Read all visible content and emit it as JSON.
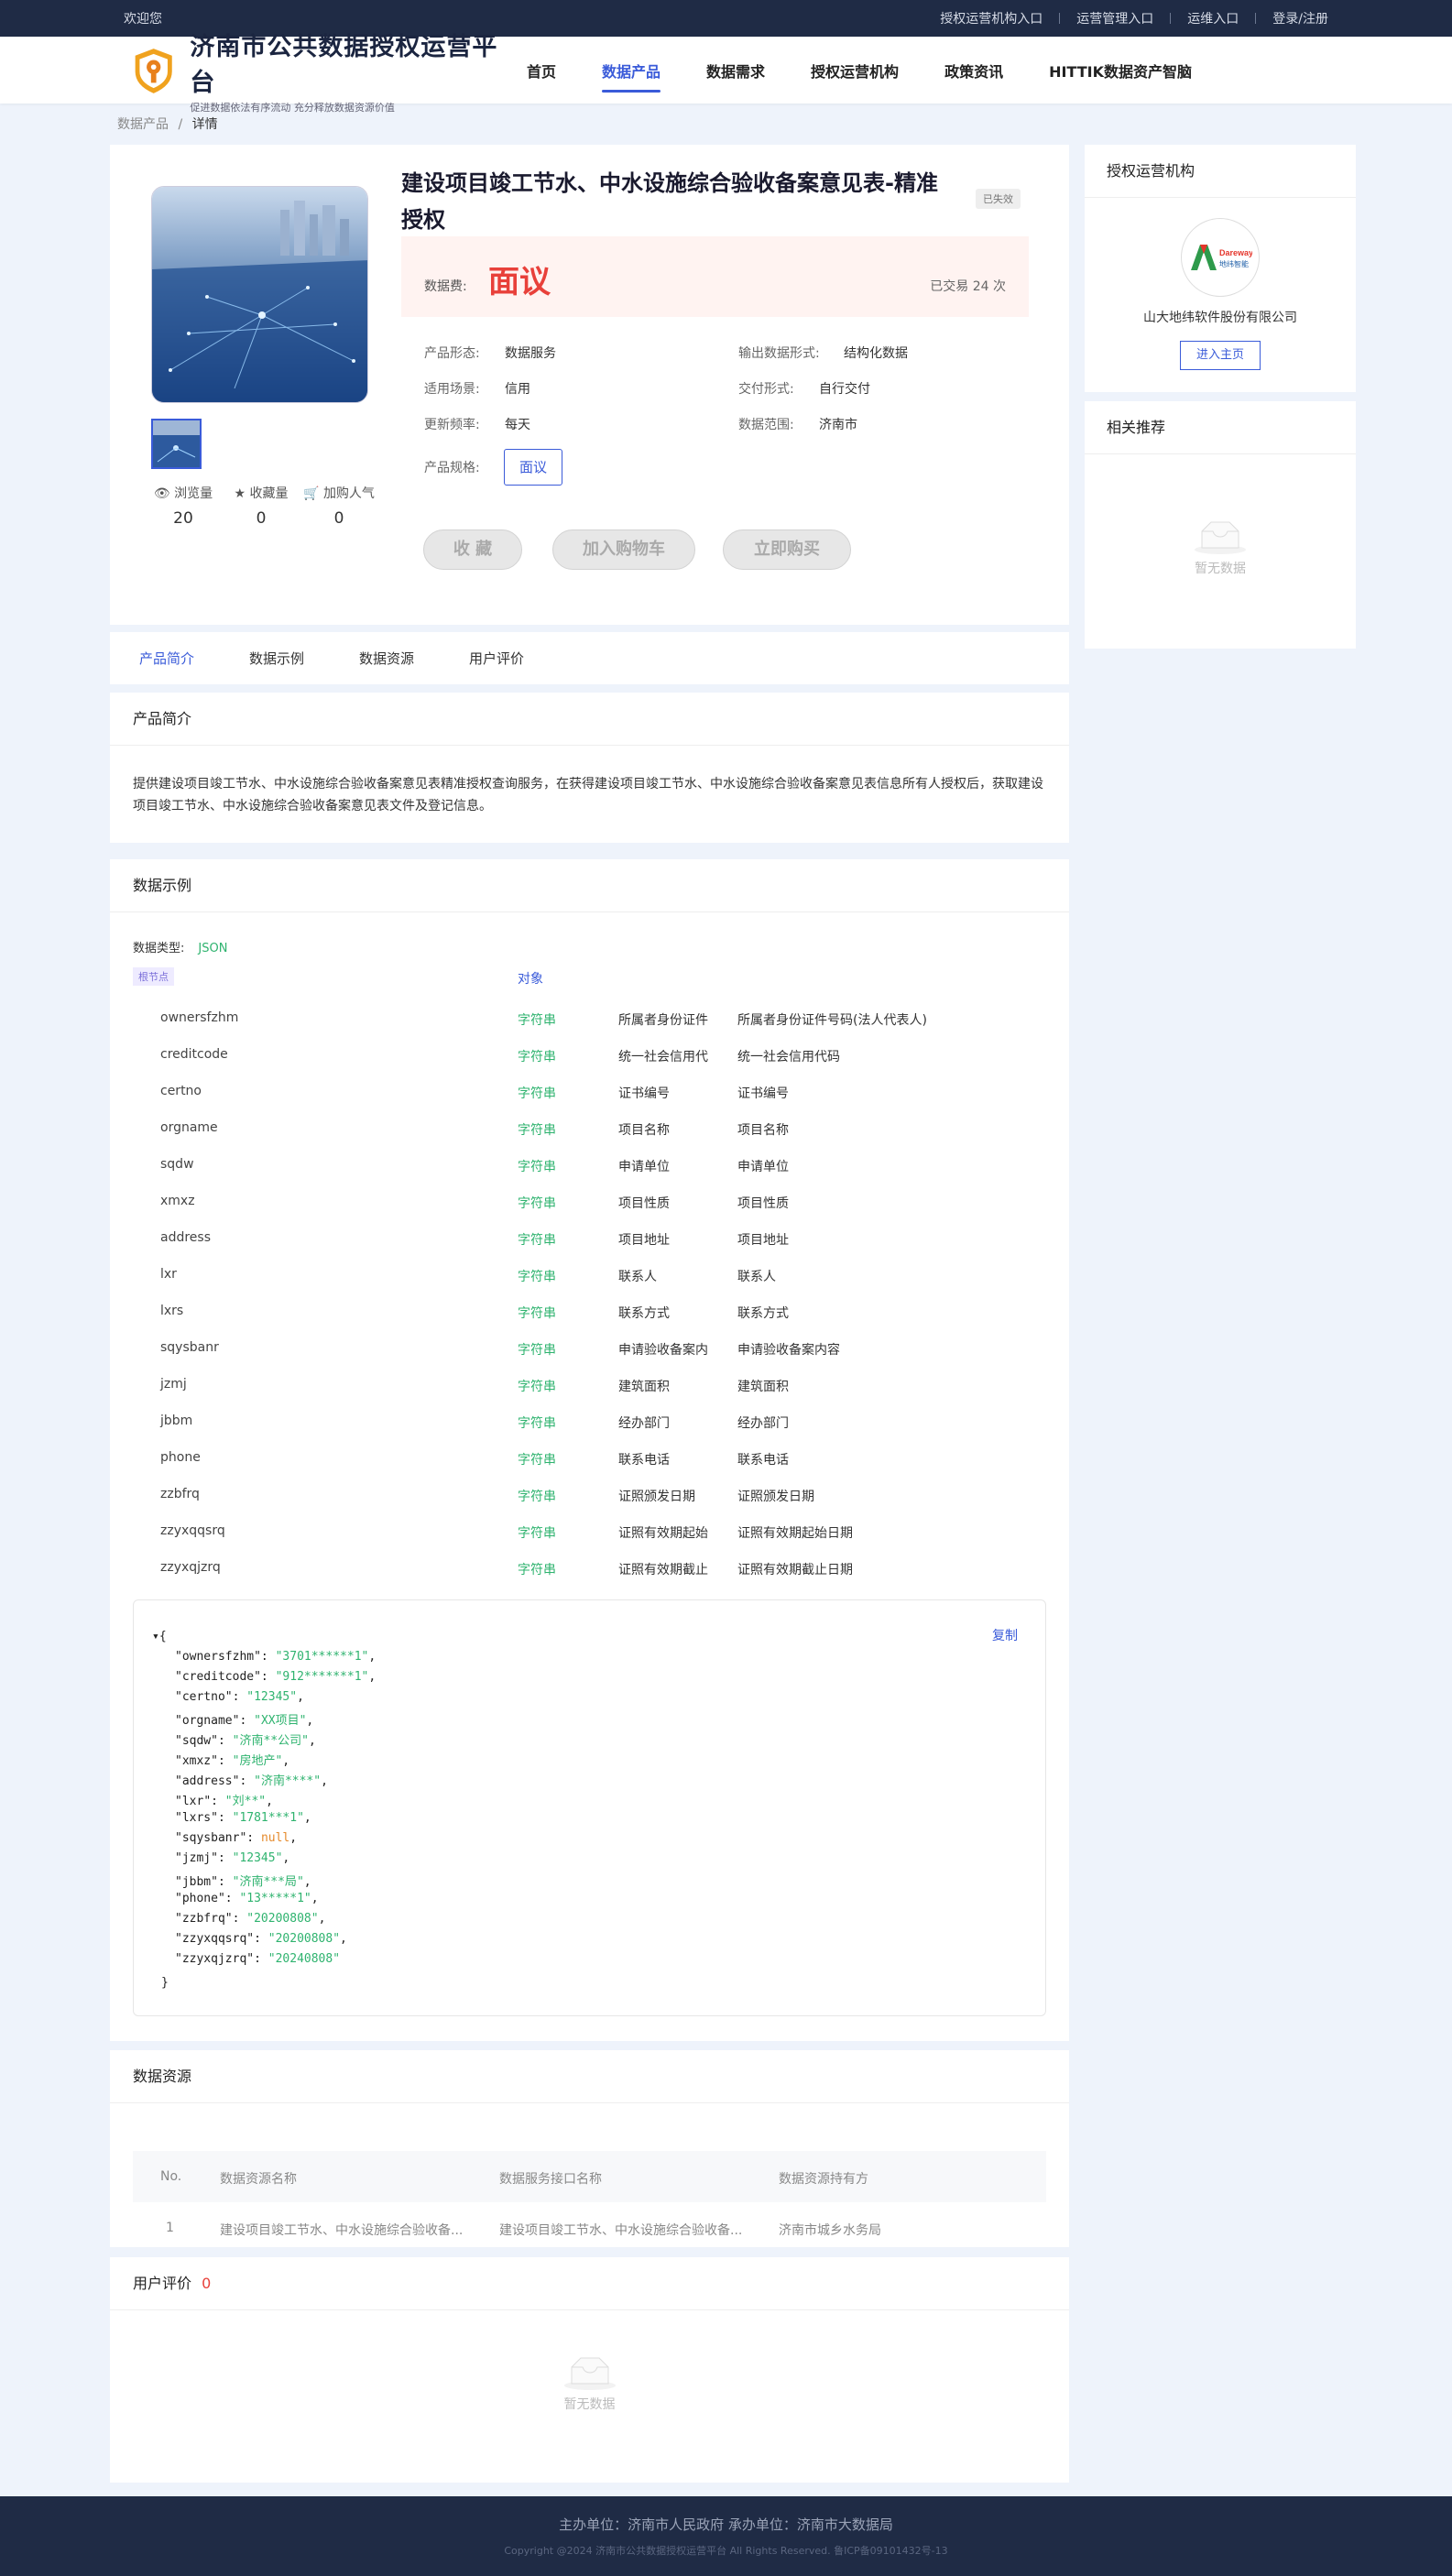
{
  "topbar": {
    "welcome": "欢迎您",
    "links": [
      "授权运营机构入口",
      "运营管理入口",
      "运维入口",
      "登录/注册"
    ]
  },
  "header": {
    "title": "济南市公共数据授权运营平台",
    "subtitle": "促进数据依法有序流动 充分释放数据资源价值"
  },
  "nav": [
    {
      "label": "首页",
      "active": false
    },
    {
      "label": "数据产品",
      "active": true
    },
    {
      "label": "数据需求",
      "active": false
    },
    {
      "label": "授权运营机构",
      "active": false
    },
    {
      "label": "政策资讯",
      "active": false
    },
    {
      "label": "HITTIK数据资产智脑",
      "active": false
    }
  ],
  "breadcrumb": {
    "parent": "数据产品",
    "sep": "/",
    "current": "详情"
  },
  "product": {
    "title": "建设项目竣工节水、中水设施综合验收备案意见表-精准授权",
    "status": "已失效",
    "price_label": "数据费:",
    "price": "面议",
    "traded": "已交易 24 次",
    "attrs": {
      "form_k": "产品形态:",
      "form_v": "数据服务",
      "output_k": "输出数据形式:",
      "output_v": "结构化数据",
      "scene_k": "适用场景:",
      "scene_v": "信用",
      "delivery_k": "交付形式:",
      "delivery_v": "自行交付",
      "freq_k": "更新频率:",
      "freq_v": "每天",
      "range_k": "数据范围:",
      "range_v": "济南市",
      "spec_k": "产品规格:",
      "spec_v": "面议"
    },
    "stats": [
      {
        "label": "浏览量",
        "value": "20"
      },
      {
        "label": "收藏量",
        "value": "0"
      },
      {
        "label": "加购人气",
        "value": "0"
      }
    ],
    "buttons": {
      "fav": "收 藏",
      "cart": "加入购物车",
      "buy": "立即购买"
    }
  },
  "org": {
    "section": "授权运营机构",
    "logo_top": "Dareway",
    "logo_bottom": "地纬智能",
    "name": "山大地纬软件股份有限公司",
    "home_btn": "进入主页"
  },
  "related": {
    "section": "相关推荐",
    "empty": "暂无数据"
  },
  "tabs": [
    "产品简介",
    "数据示例",
    "数据资源",
    "用户评价"
  ],
  "intro": {
    "section": "产品简介",
    "text": "提供建设项目竣工节水、中水设施综合验收备案意见表精准授权查询服务，在获得建设项目竣工节水、中水设施综合验收备案意见表信息所有人授权后，获取建设项目竣工节水、中水设施综合验收备案意见表文件及登记信息。"
  },
  "sample": {
    "section": "数据示例",
    "type_label": "数据类型:",
    "type_value": "JSON",
    "root": "根节点",
    "object": "对象",
    "fields": [
      [
        "ownersfzhm",
        "字符串",
        "所属者身份证件",
        "所属者身份证件号码(法人代表人)"
      ],
      [
        "creditcode",
        "字符串",
        "统一社会信用代",
        "统一社会信用代码"
      ],
      [
        "certno",
        "字符串",
        "证书编号",
        "证书编号"
      ],
      [
        "orgname",
        "字符串",
        "项目名称",
        "项目名称"
      ],
      [
        "sqdw",
        "字符串",
        "申请单位",
        "申请单位"
      ],
      [
        "xmxz",
        "字符串",
        "项目性质",
        "项目性质"
      ],
      [
        "address",
        "字符串",
        "项目地址",
        "项目地址"
      ],
      [
        "lxr",
        "字符串",
        "联系人",
        "联系人"
      ],
      [
        "lxrs",
        "字符串",
        "联系方式",
        "联系方式"
      ],
      [
        "sqysbanr",
        "字符串",
        "申请验收备案内",
        "申请验收备案内容"
      ],
      [
        "jzmj",
        "字符串",
        "建筑面积",
        "建筑面积"
      ],
      [
        "jbbm",
        "字符串",
        "经办部门",
        "经办部门"
      ],
      [
        "phone",
        "字符串",
        "联系电话",
        "联系电话"
      ],
      [
        "zzbfrq",
        "字符串",
        "证照颁发日期",
        "证照颁发日期"
      ],
      [
        "zzyxqqsrq",
        "字符串",
        "证照有效期起始",
        "证照有效期起始日期"
      ],
      [
        "zzyxqjzrq",
        "字符串",
        "证照有效期截止",
        "证照有效期截止日期"
      ]
    ],
    "copy": "复制",
    "json": [
      [
        "ownersfzhm",
        "3701******1"
      ],
      [
        "creditcode",
        "912*******1"
      ],
      [
        "certno",
        "12345"
      ],
      [
        "orgname",
        "XX项目"
      ],
      [
        "sqdw",
        "济南**公司"
      ],
      [
        "xmxz",
        "房地产"
      ],
      [
        "address",
        "济南****"
      ],
      [
        "lxr",
        "刘**"
      ],
      [
        "lxrs",
        "1781***1"
      ],
      [
        "sqysbanr",
        null
      ],
      [
        "jzmj",
        "12345"
      ],
      [
        "jbbm",
        "济南***局"
      ],
      [
        "phone",
        "13*****1"
      ],
      [
        "zzbfrq",
        "20200808"
      ],
      [
        "zzyxqqsrq",
        "20200808"
      ],
      [
        "zzyxqjzrq",
        "20240808"
      ]
    ]
  },
  "resources": {
    "section": "数据资源",
    "headers": [
      "No.",
      "数据资源名称",
      "数据服务接口名称",
      "数据资源持有方"
    ],
    "rows": [
      [
        "1",
        "建设项目竣工节水、中水设施综合验收备...",
        "建设项目竣工节水、中水设施综合验收备...",
        "济南市城乡水务局"
      ]
    ]
  },
  "reviews": {
    "section": "用户评价",
    "count": "0",
    "empty": "暂无数据"
  },
  "footer": {
    "line1": "主办单位：济南市人民政府    承办单位：济南市大数据局",
    "line2": "Copyright @2024 济南市公共数据授权运营平台 All Rights Reserved. 鲁ICP备09101432号-13"
  }
}
